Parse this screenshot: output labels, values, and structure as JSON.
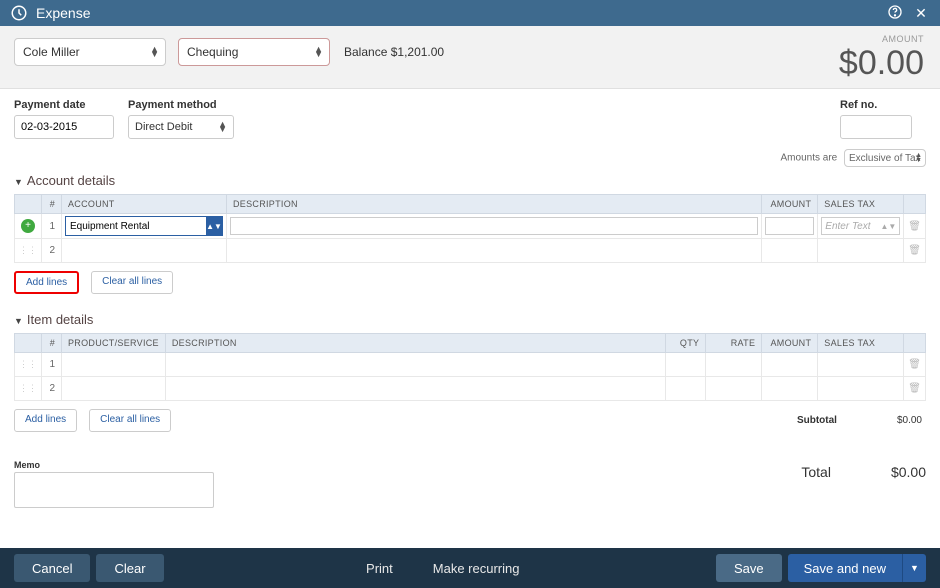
{
  "titlebar": {
    "title": "Expense"
  },
  "subheader": {
    "payee": "Cole Miller",
    "account": "Chequing",
    "balance_label": "Balance",
    "balance_value": "$1,201.00",
    "amount_label": "AMOUNT",
    "amount_value": "$0.00"
  },
  "fields": {
    "payment_date_label": "Payment date",
    "payment_date_value": "02-03-2015",
    "payment_method_label": "Payment method",
    "payment_method_value": "Direct Debit",
    "ref_no_label": "Ref no.",
    "ref_no_value": "",
    "amounts_are_label": "Amounts are",
    "amounts_are_value": "Exclusive of Tax"
  },
  "sections": {
    "account_details": "Account details",
    "item_details": "Item details"
  },
  "account_table": {
    "headers": {
      "num": "#",
      "account": "ACCOUNT",
      "description": "DESCRIPTION",
      "amount": "AMOUNT",
      "sales_tax": "SALES TAX"
    },
    "rows": [
      {
        "num": "1",
        "account": "Equipment Rental",
        "sales_tax_placeholder": "Enter Text"
      },
      {
        "num": "2"
      }
    ]
  },
  "item_table": {
    "headers": {
      "num": "#",
      "product": "PRODUCT/SERVICE",
      "description": "DESCRIPTION",
      "qty": "QTY",
      "rate": "RATE",
      "amount": "AMOUNT",
      "sales_tax": "SALES TAX"
    },
    "rows": [
      {
        "num": "1"
      },
      {
        "num": "2"
      }
    ]
  },
  "buttons": {
    "add_lines": "Add lines",
    "clear_all_lines": "Clear all lines"
  },
  "totals": {
    "subtotal_label": "Subtotal",
    "subtotal_value": "$0.00",
    "total_label": "Total",
    "total_value": "$0.00"
  },
  "memo": {
    "label": "Memo",
    "value": ""
  },
  "footer": {
    "cancel": "Cancel",
    "clear": "Clear",
    "print": "Print",
    "make_recurring": "Make recurring",
    "save": "Save",
    "save_and_new": "Save and new"
  }
}
